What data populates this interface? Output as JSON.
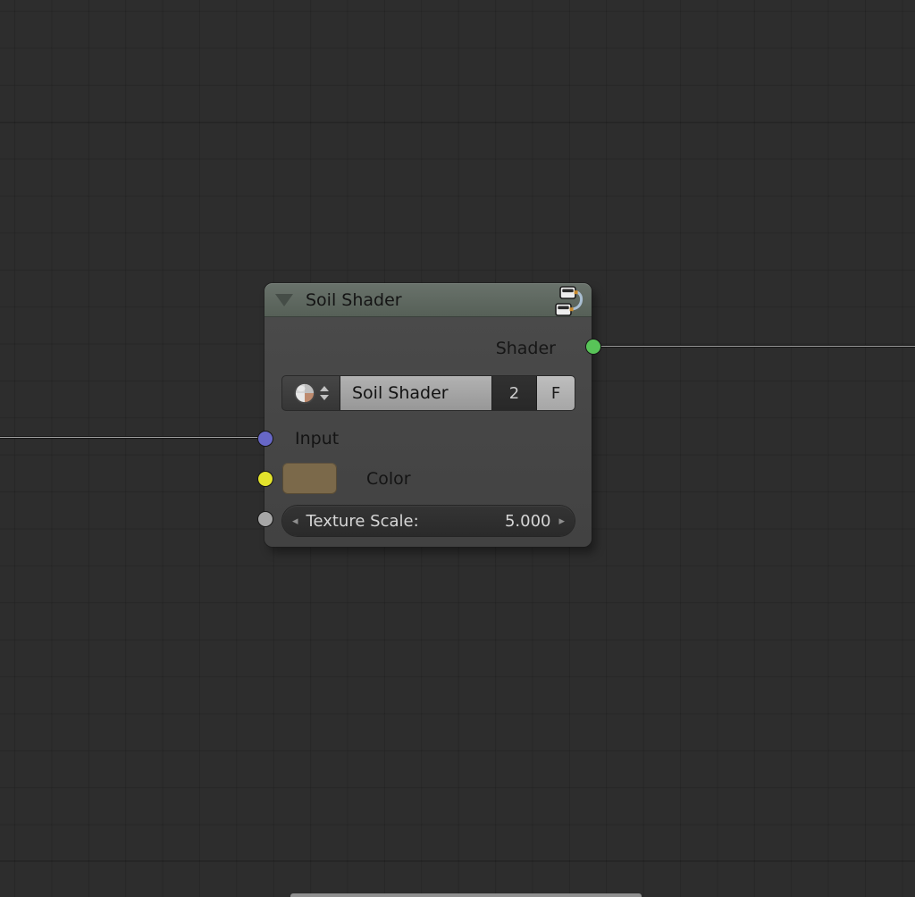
{
  "canvas": {
    "background_color": "#2d2d2d",
    "grid_line_color": "rgba(0,0,0,0.13)",
    "link_color": "#a6a6a6",
    "partial_node_edge_color": "#8f8f8f"
  },
  "node": {
    "title": "Soil Shader",
    "header_color": "#5d675e",
    "body_color": "#474747",
    "output": {
      "label": "Shader",
      "socket_color": "#58c458"
    },
    "datablock": {
      "icon": "material-sphere-icon",
      "name_value": "Soil Shader",
      "users_count": "2",
      "fake_user_label": "F"
    },
    "inputs": {
      "input": {
        "label": "Input",
        "socket_color": "#6767c7"
      },
      "color": {
        "label": "Color",
        "socket_color": "#e3e32c",
        "swatch_color": "#7b694a"
      },
      "texture_scale": {
        "label": "Texture Scale:",
        "value": "5.000",
        "socket_color": "#a6a6a6",
        "decrease_glyph": "◂",
        "increase_glyph": "▸"
      }
    }
  }
}
